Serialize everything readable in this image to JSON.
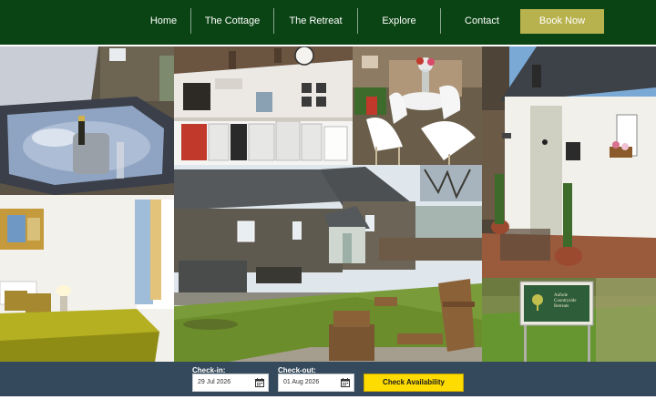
{
  "nav": {
    "items": [
      {
        "label": "Home"
      },
      {
        "label": "The Cottage"
      },
      {
        "label": "The Retreat"
      },
      {
        "label": "Explore"
      },
      {
        "label": "Contact"
      }
    ],
    "book_now": "Book Now"
  },
  "gallery": {
    "sign_text_line1": "Aufode",
    "sign_text_line2": "Countryside",
    "sign_text_line3": "Retreats"
  },
  "booking": {
    "checkin_label": "Check-in:",
    "checkin_value": "29 Jul 2026",
    "checkout_label": "Check-out:",
    "checkout_value": "01 Aug 2026",
    "check_button": "Check Availability"
  },
  "colors": {
    "header_bg": "#0b4414",
    "book_button": "#b8b24e",
    "booking_bar": "#34495b",
    "check_button": "#ffdc00"
  },
  "icons": [
    "calendar-icon"
  ]
}
